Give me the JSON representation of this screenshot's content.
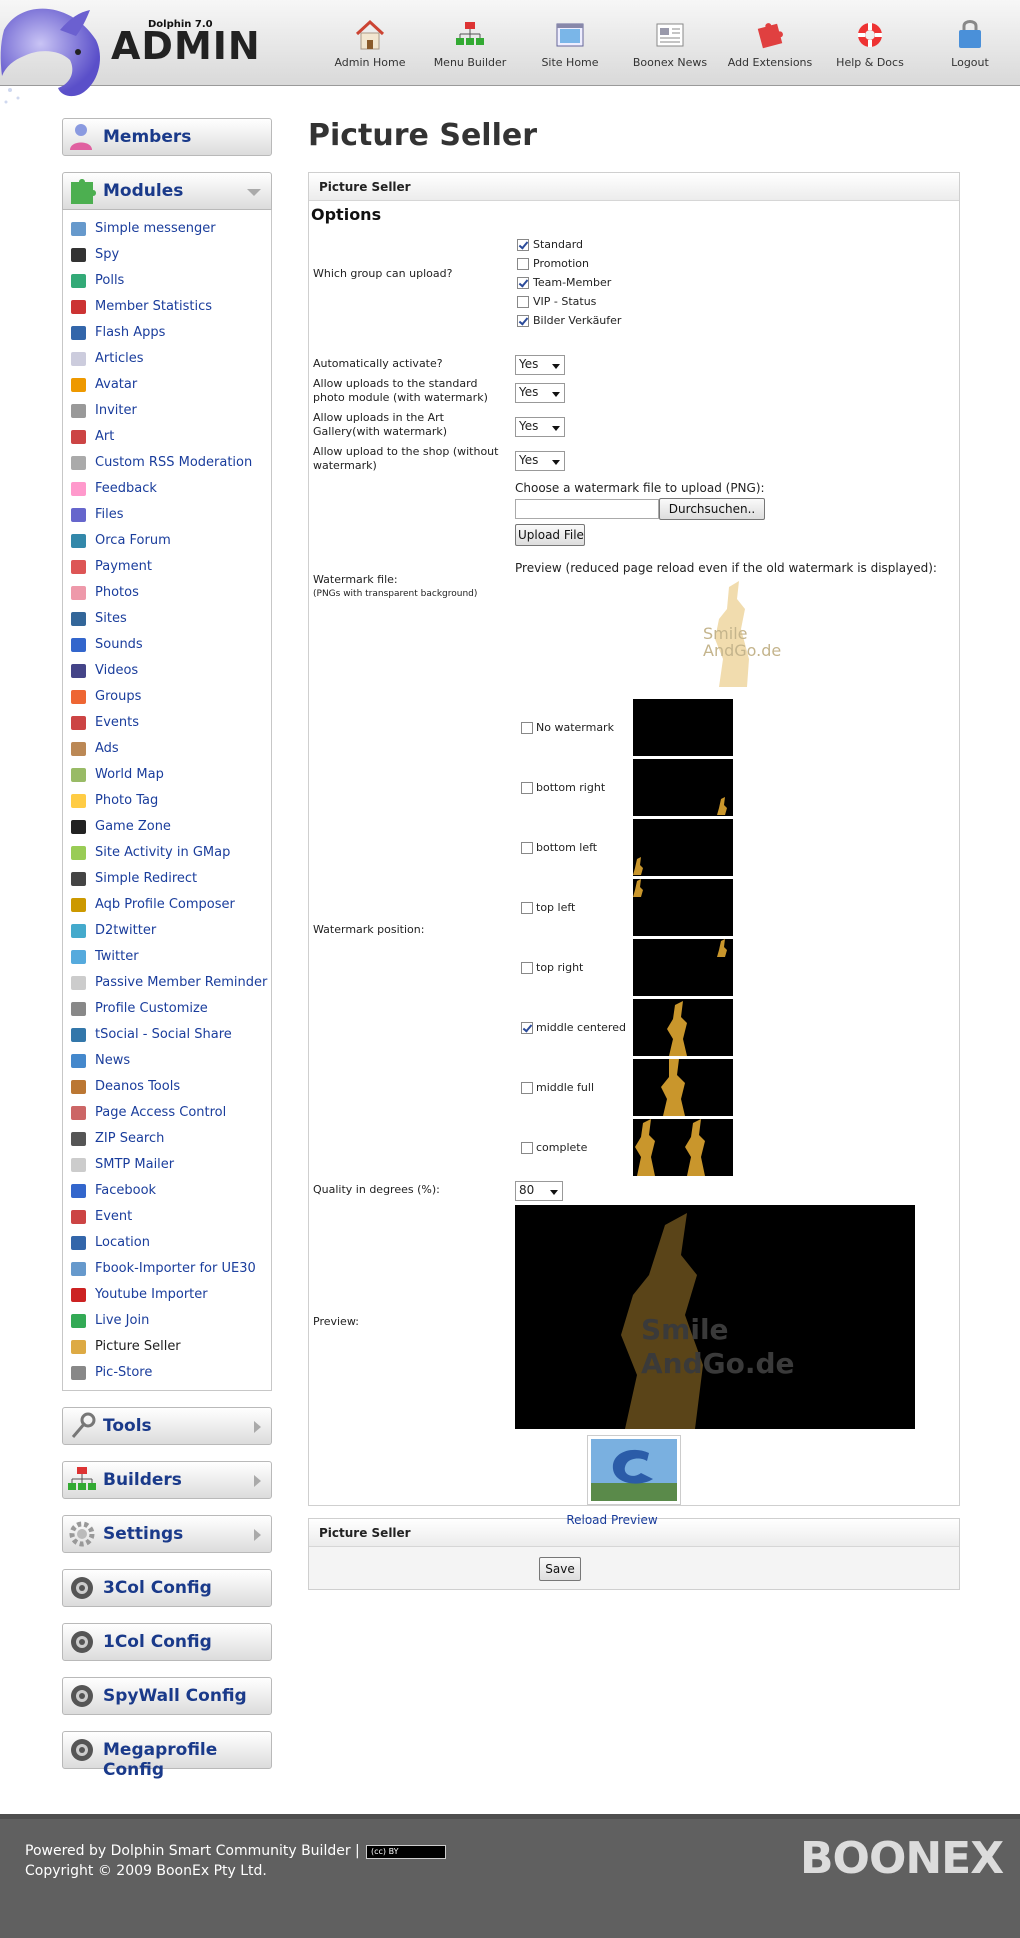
{
  "header": {
    "logo_small": "Dolphin 7.0",
    "logo_big": "ADMIN",
    "nav": [
      {
        "label": "Admin Home",
        "icon": "home-icon"
      },
      {
        "label": "Menu Builder",
        "icon": "menu-builder-icon"
      },
      {
        "label": "Site Home",
        "icon": "site-home-icon"
      },
      {
        "label": "Boonex News",
        "icon": "news-icon"
      },
      {
        "label": "Add Extensions",
        "icon": "puzzle-icon"
      },
      {
        "label": "Help & Docs",
        "icon": "lifebuoy-icon"
      },
      {
        "label": "Logout",
        "icon": "logout-icon"
      }
    ]
  },
  "sidebar": {
    "members": "Members",
    "modules": "Modules",
    "modules_items": [
      "Simple messenger",
      "Spy",
      "Polls",
      "Member Statistics",
      "Flash Apps",
      "Articles",
      "Avatar",
      "Inviter",
      "Art",
      "Custom RSS Moderation",
      "Feedback",
      "Files",
      "Orca Forum",
      "Payment",
      "Photos",
      "Sites",
      "Sounds",
      "Videos",
      "Groups",
      "Events",
      "Ads",
      "World Map",
      "Photo Tag",
      "Game Zone",
      "Site Activity in GMap",
      "Simple Redirect",
      "Aqb Profile Composer",
      "D2twitter",
      "Twitter",
      "Passive Member Reminder",
      "Profile Customize",
      "tSocial - Social Share",
      "News",
      "Deanos Tools",
      "Page Access Control",
      "ZIP Search",
      "SMTP Mailer",
      "Facebook",
      "Event",
      "Location",
      "Fbook-Importer for UE30",
      "Youtube Importer",
      "Live Join",
      "Picture Seller",
      "Pic-Store"
    ],
    "current_module": "Picture Seller",
    "tools": "Tools",
    "builders": "Builders",
    "settings": "Settings",
    "config_3col": "3Col Config",
    "config_1col": "1Col Config",
    "config_spywall": "SpyWall Config",
    "config_megaprofile": "Megaprofile Config"
  },
  "main": {
    "page_title": "Picture Seller",
    "block_title": "Picture Seller",
    "options_title": "Options",
    "upload_group_label": "Which group can upload?",
    "groups": [
      {
        "label": "Standard",
        "checked": true
      },
      {
        "label": "Promotion",
        "checked": false
      },
      {
        "label": "Team-Member",
        "checked": true
      },
      {
        "label": "VIP - Status",
        "checked": false
      },
      {
        "label": "Bilder Verkäufer",
        "checked": true
      }
    ],
    "auto_activate_label": "Automatically activate?",
    "auto_activate_value": "Yes",
    "std_photo_label": "Allow uploads to the standard photo module (with watermark)",
    "std_photo_value": "Yes",
    "art_gallery_label": "Allow uploads in the Art Gallery(with watermark)",
    "art_gallery_value": "Yes",
    "shop_label": "Allow upload to the shop (without watermark)",
    "shop_value": "Yes",
    "choose_watermark": "Choose a watermark file to upload (PNG):",
    "browse_button": "Durchsuchen..",
    "upload_button": "Upload File",
    "watermark_file_label": "Watermark file:",
    "watermark_file_sub": "(PNGs with transparent background)",
    "preview_note": "Preview (reduced page reload even if the old watermark is displayed):",
    "watermark_preview_text1": "Smile",
    "watermark_preview_text2": "AndGo.de",
    "watermark_position_label": "Watermark position:",
    "positions": [
      {
        "label": "No watermark",
        "checked": false
      },
      {
        "label": "bottom right",
        "checked": false
      },
      {
        "label": "bottom left",
        "checked": false
      },
      {
        "label": "top left",
        "checked": false
      },
      {
        "label": "top right",
        "checked": false
      },
      {
        "label": "middle centered",
        "checked": true
      },
      {
        "label": "middle full",
        "checked": false
      },
      {
        "label": "complete",
        "checked": false
      }
    ],
    "quality_label": "Quality in degrees (%):",
    "quality_value": "80",
    "preview_label": "Preview:",
    "big_preview_text1": "Smile",
    "big_preview_text2": "AndGo.de",
    "reload_preview": "Reload Preview",
    "save_block_title": "Picture Seller",
    "save_button": "Save"
  },
  "footer": {
    "powered": "Powered by Dolphin Smart Community Builder |",
    "copyright": "Copyright © 2009 BoonEx Pty Ltd.",
    "cc_badge": "(cc) BY",
    "brand": "BOONEX"
  },
  "colors": {
    "link": "#1a3d9c",
    "heading": "#1a3a8a",
    "footer_bg": "#606060",
    "watermark": "#c9962c"
  }
}
